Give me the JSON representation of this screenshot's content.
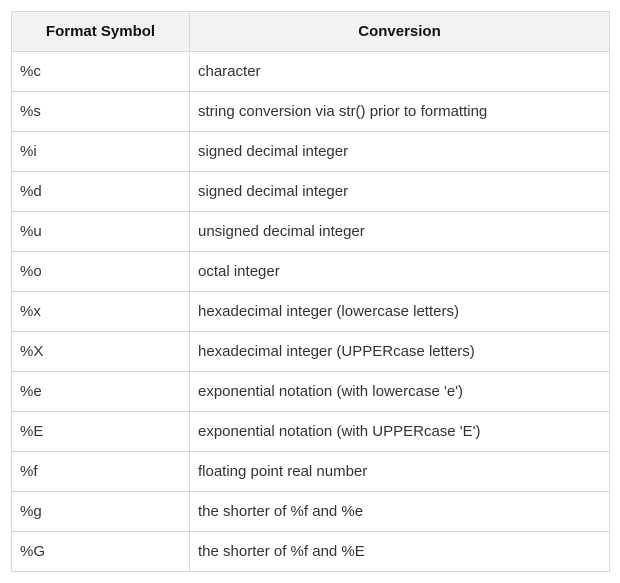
{
  "table": {
    "headers": [
      "Format Symbol",
      "Conversion"
    ],
    "rows": [
      [
        "%c",
        "character"
      ],
      [
        "%s",
        "string conversion via str() prior to formatting"
      ],
      [
        "%i",
        "signed decimal integer"
      ],
      [
        "%d",
        "signed decimal integer"
      ],
      [
        "%u",
        "unsigned decimal integer"
      ],
      [
        "%o",
        "octal integer"
      ],
      [
        "%x",
        "hexadecimal integer (lowercase letters)"
      ],
      [
        "%X",
        "hexadecimal integer (UPPERcase letters)"
      ],
      [
        "%e",
        "exponential notation (with lowercase 'e')"
      ],
      [
        "%E",
        "exponential notation (with UPPERcase 'E')"
      ],
      [
        "%f",
        "floating point real number"
      ],
      [
        "%g",
        "the shorter of %f and %e"
      ],
      [
        "%G",
        "the shorter of %f and %E"
      ]
    ]
  },
  "colors": {
    "header_bg": "#f2f2f2",
    "border": "#d8d8d8",
    "text": "#333333"
  }
}
